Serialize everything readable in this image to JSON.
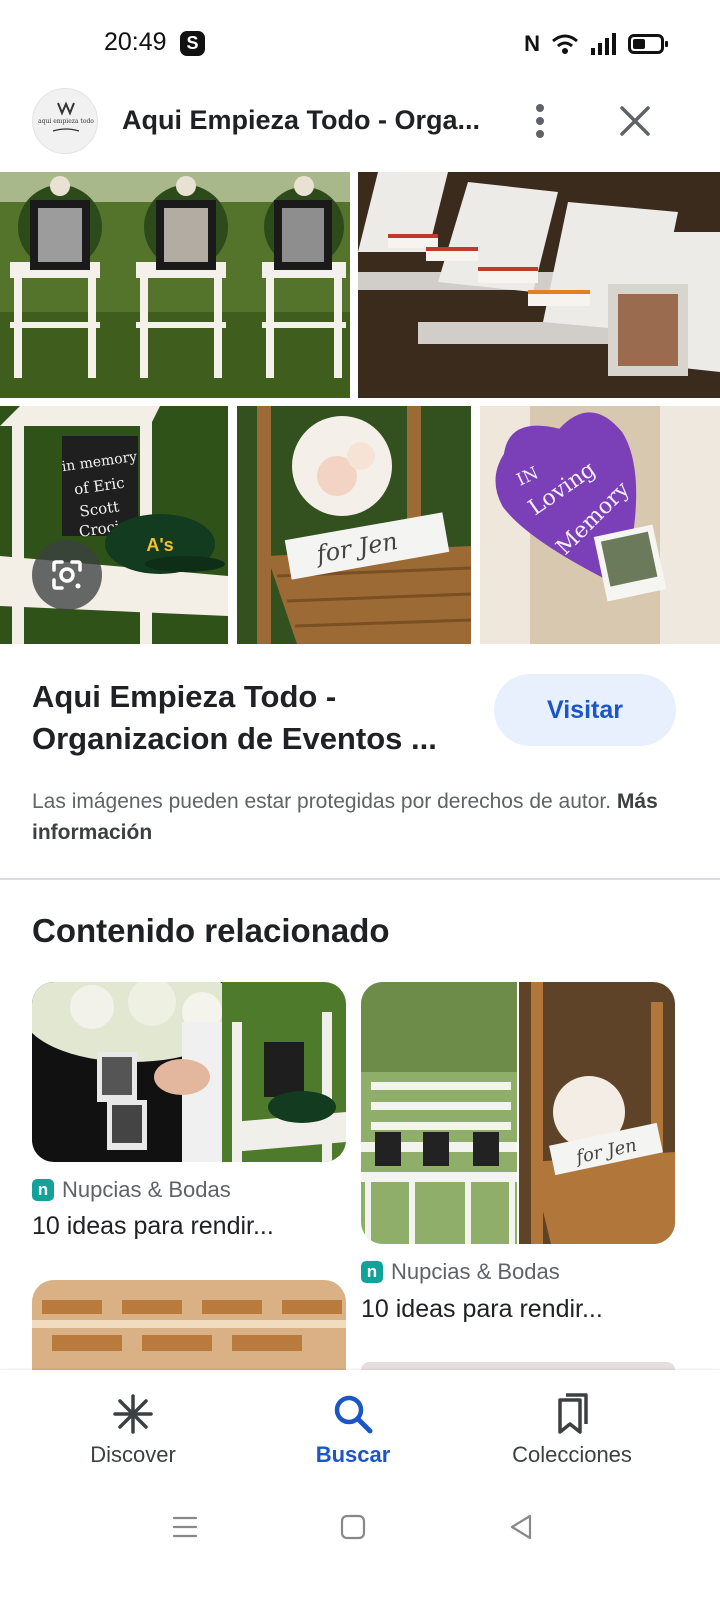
{
  "status_bar": {
    "time": "20:49",
    "app_badge": "S",
    "icons": [
      "nfc-icon",
      "wifi-icon",
      "signal-icon",
      "battery-icon"
    ]
  },
  "header": {
    "title": "Aqui Empieza Todo - Orga...",
    "logo_text": "aqui empieza todo",
    "menu_icon": "more-vert-icon",
    "close_icon": "close-icon"
  },
  "collage": {
    "images": [
      {
        "name": "memorial-chairs-portraits"
      },
      {
        "name": "reserved-chairs-frame"
      },
      {
        "name": "in-memory-chalkboard-chair"
      },
      {
        "name": "for-jen-bouquet-chair"
      },
      {
        "name": "in-loving-memory-heart-chair"
      }
    ],
    "chalk_text": "in memory of Eric Scott Croci",
    "sign_text": "for Jen",
    "heart_text": "IN Loving Memory",
    "lens_icon": "google-lens-icon"
  },
  "result": {
    "title": "Aqui Empieza Todo - Organizacion de Eventos ...",
    "visit_label": "Visitar",
    "copyright_text": "Las imágenes pueden estar protegidas por derechos de autor.",
    "more_info": "Más información"
  },
  "related": {
    "heading": "Contenido relacionado",
    "cards": [
      {
        "source": "Nupcias & Bodas",
        "caption": "10 ideas para rendir..."
      },
      {
        "source": "Nupcias & Bodas",
        "caption": "10 ideas para rendir..."
      }
    ]
  },
  "bottom_nav": {
    "items": [
      {
        "label": "Discover",
        "icon": "asterisk-icon"
      },
      {
        "label": "Buscar",
        "icon": "search-icon",
        "active": true
      },
      {
        "label": "Colecciones",
        "icon": "bookmarks-icon"
      }
    ]
  },
  "system_nav": {
    "icons": [
      "recent-apps-icon",
      "home-icon",
      "back-icon"
    ]
  },
  "colors": {
    "accent_blue": "#1a56c6",
    "visit_bg": "#e8f0fe",
    "source_teal": "#13a29a",
    "heart_purple": "#7b3fb8"
  }
}
